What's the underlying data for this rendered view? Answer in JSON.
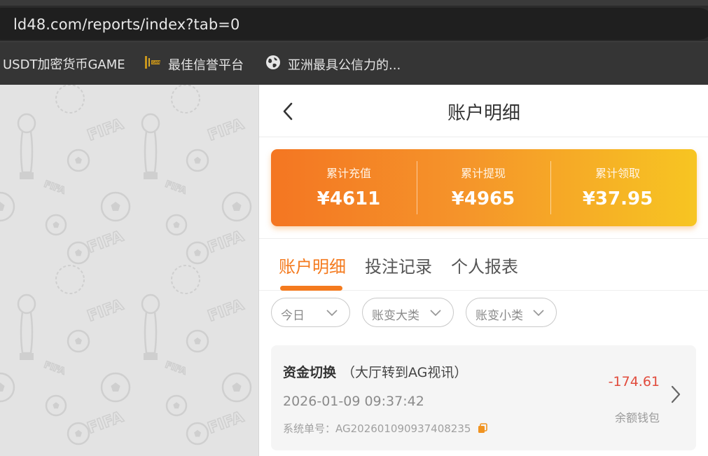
{
  "browser": {
    "url": "ld48.com/reports/index?tab=0",
    "bookmarks": [
      {
        "label": "USDT加密货币GAME",
        "icon": "none"
      },
      {
        "label": "最佳信誉平台",
        "icon": "gold-logo-icon"
      },
      {
        "label": "亚洲最具公信力的...",
        "icon": "globe-icon"
      }
    ]
  },
  "background": {
    "pattern_text": "FIFA"
  },
  "header": {
    "title": "账户明细",
    "back_icon": "chevron-left-icon"
  },
  "summary": {
    "items": [
      {
        "label": "累计充值",
        "value": "¥4611"
      },
      {
        "label": "累计提现",
        "value": "¥4965"
      },
      {
        "label": "累计领取",
        "value": "¥37.95"
      }
    ],
    "gradient_colors": [
      "#f47622",
      "#f7c522"
    ]
  },
  "tabs": [
    {
      "label": "账户明细",
      "active": true
    },
    {
      "label": "投注记录",
      "active": false
    },
    {
      "label": "个人报表",
      "active": false
    }
  ],
  "filters": [
    {
      "label": "今日"
    },
    {
      "label": "账变大类"
    },
    {
      "label": "账变小类"
    }
  ],
  "record": {
    "type": "资金切换",
    "detail": "（大厅转到AG视讯）",
    "time": "2026-01-09 09:37:42",
    "order_label": "系统单号：",
    "order_no": "AG202601090937408235",
    "amount": "-174.61",
    "wallet": "余额钱包"
  },
  "colors": {
    "accent": "#f47a1e",
    "negative": "#e14b3c"
  }
}
